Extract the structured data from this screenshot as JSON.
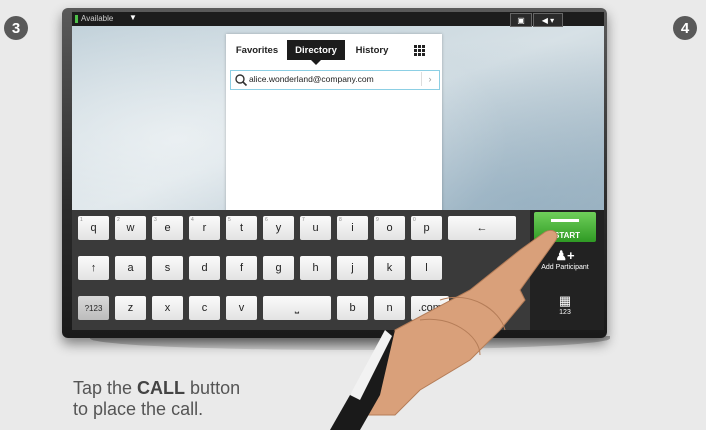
{
  "steps": {
    "current": "3",
    "next": "4"
  },
  "statusbar": {
    "presence": "Available",
    "presence_color": "#4fbf4a"
  },
  "directory": {
    "tabs": [
      {
        "label": "Favorites"
      },
      {
        "label": "Directory",
        "active": true
      },
      {
        "label": "History"
      },
      {
        "label": "keypad-grid-icon"
      }
    ],
    "search_value": "alice.wonderland@company.com",
    "search_go": "›"
  },
  "keyboard": {
    "row1": [
      "q",
      "w",
      "e",
      "r",
      "t",
      "y",
      "u",
      "i",
      "o",
      "p",
      "←"
    ],
    "row1_hints": [
      "1",
      "2",
      "3",
      "4",
      "5",
      "6",
      "7",
      "8",
      "9",
      "0",
      ""
    ],
    "row2": [
      "↑",
      "a",
      "s",
      "d",
      "f",
      "g",
      "h",
      "j",
      "k",
      "l"
    ],
    "row3": [
      "?123",
      "z",
      "x",
      "c",
      "v",
      "space",
      "b",
      "n",
      ".com"
    ]
  },
  "side_panel": {
    "start_label": "START",
    "add_label": "Add Participant",
    "keypad_label": "123",
    "start_color": "#3aa62e"
  },
  "caption": {
    "prefix": "Tap the ",
    "bold": "CALL",
    "suffix": " button",
    "line2": "to place the call."
  }
}
